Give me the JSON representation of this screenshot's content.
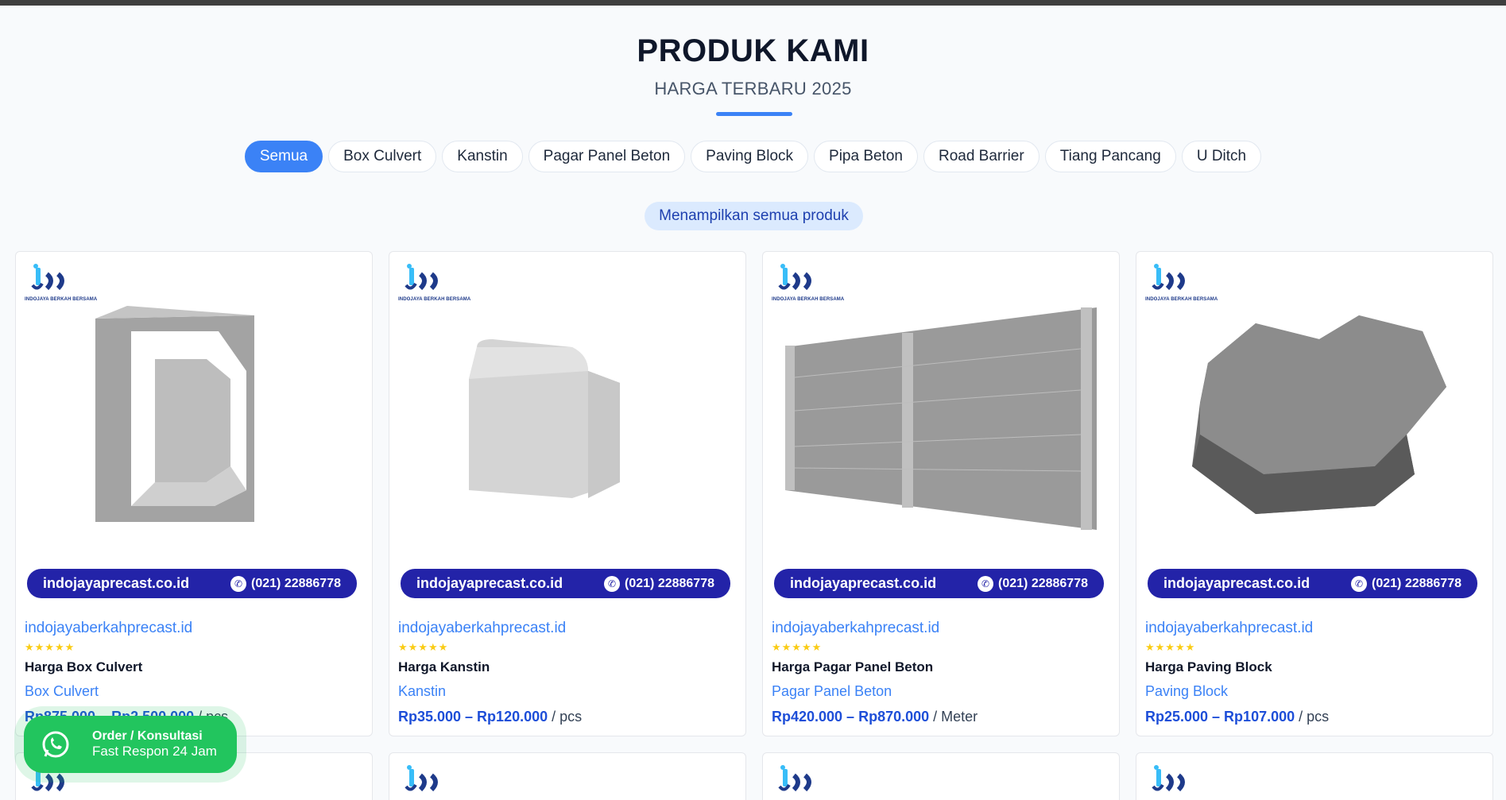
{
  "heading": {
    "title": "PRODUK KAMI",
    "subtitle": "HARGA TERBARU 2025"
  },
  "filters": [
    {
      "label": "Semua",
      "active": true
    },
    {
      "label": "Box Culvert",
      "active": false
    },
    {
      "label": "Kanstin",
      "active": false
    },
    {
      "label": "Pagar Panel Beton",
      "active": false
    },
    {
      "label": "Paving Block",
      "active": false
    },
    {
      "label": "Pipa Beton",
      "active": false
    },
    {
      "label": "Road Barrier",
      "active": false
    },
    {
      "label": "Tiang Pancang",
      "active": false
    },
    {
      "label": "U Ditch",
      "active": false
    }
  ],
  "info": "Menampilkan semua produk",
  "products": [
    {
      "logo_text": "INDOJAYA BERKAH BERSAMA",
      "banner_site": "indojayaprecast.co.id",
      "banner_phone": "(021) 22886778",
      "site": "indojayaberkahprecast.id",
      "stars": "★★★★★",
      "name": "Harga Box Culvert",
      "category": "Box Culvert",
      "price": "Rp875.000 – Rp2.500.000",
      "unit": "/ pcs"
    },
    {
      "logo_text": "INDOJAYA BERKAH BERSAMA",
      "banner_site": "indojayaprecast.co.id",
      "banner_phone": "(021) 22886778",
      "site": "indojayaberkahprecast.id",
      "stars": "★★★★★",
      "name": "Harga Kanstin",
      "category": "Kanstin",
      "price": "Rp35.000 – Rp120.000",
      "unit": "/ pcs"
    },
    {
      "logo_text": "INDOJAYA BERKAH BERSAMA",
      "banner_site": "indojayaprecast.co.id",
      "banner_phone": "(021) 22886778",
      "site": "indojayaberkahprecast.id",
      "stars": "★★★★★",
      "name": "Harga Pagar Panel Beton",
      "category": "Pagar Panel Beton",
      "price": "Rp420.000 – Rp870.000",
      "unit": "/ Meter"
    },
    {
      "logo_text": "INDOJAYA BERKAH BERSAMA",
      "banner_site": "indojayaprecast.co.id",
      "banner_phone": "(021) 22886778",
      "site": "indojayaberkahprecast.id",
      "stars": "★★★★★",
      "name": "Harga Paving Block",
      "category": "Paving Block",
      "price": "Rp25.000 – Rp107.000",
      "unit": "/ pcs"
    }
  ],
  "whatsapp": {
    "title": "Order / Konsultasi",
    "subtitle": "Fast Respon 24 Jam",
    "icon": "whatsapp-icon"
  },
  "colors": {
    "accent": "#3b82f6",
    "banner": "#2323a8",
    "price": "#1d4ed8",
    "stars": "#facc15",
    "whatsapp": "#22c55e"
  }
}
